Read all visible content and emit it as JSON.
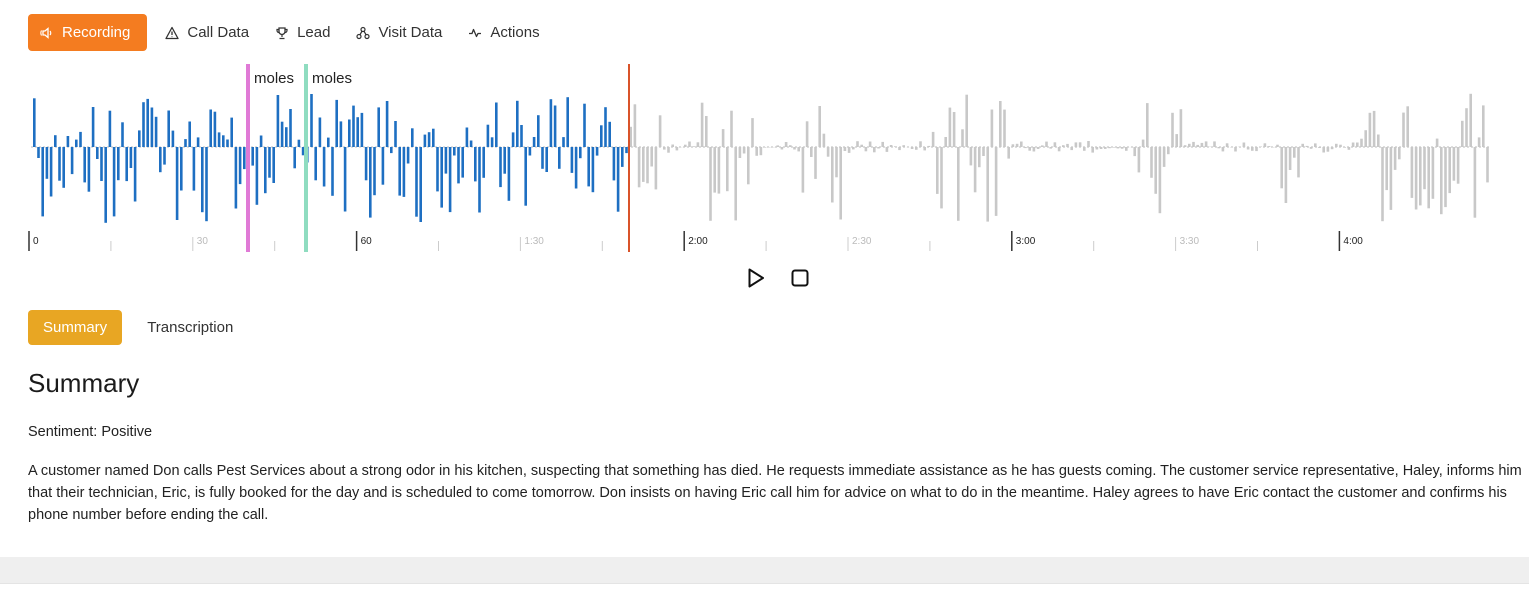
{
  "tabs": [
    {
      "label": "Recording",
      "icon": "speaker-icon",
      "active": true
    },
    {
      "label": "Call Data",
      "icon": "warning-triangle-icon",
      "active": false
    },
    {
      "label": "Lead",
      "icon": "trophy-icon",
      "active": false
    },
    {
      "label": "Visit Data",
      "icon": "network-icon",
      "active": false
    },
    {
      "label": "Actions",
      "icon": "pulse-icon",
      "active": false
    }
  ],
  "waveform": {
    "markers": [
      {
        "label": "moles",
        "color": "#e07ad6"
      },
      {
        "label": "moles",
        "color": "#8fdcc0"
      }
    ],
    "played_color": "#1e6fc2",
    "unplayed_color": "#c8c8c8",
    "playhead_color": "#d9532a",
    "time_labels": [
      {
        "label": "0",
        "major": true
      },
      {
        "label": "30",
        "major": false
      },
      {
        "label": "60",
        "major": true
      },
      {
        "label": "1:30",
        "major": false
      },
      {
        "label": "2:00",
        "major": true
      },
      {
        "label": "2:30",
        "major": false
      },
      {
        "label": "3:00",
        "major": true
      },
      {
        "label": "3:30",
        "major": false
      },
      {
        "label": "4:00",
        "major": true
      }
    ]
  },
  "controls": {
    "play": "play-icon",
    "stop": "stop-icon"
  },
  "subtabs": [
    {
      "label": "Summary",
      "active": true
    },
    {
      "label": "Transcription",
      "active": false
    }
  ],
  "summary": {
    "title": "Summary",
    "sentiment": "Sentiment: Positive",
    "text": "A customer named Don calls Pest Services about a strong odor in his kitchen, suspecting that something has died. He requests immediate assistance as he has guests coming. The customer service representative, Haley, informs him that their technician, Eric, is fully booked for the day and is scheduled to come tomorrow. Don insists on having Eric call him for advice on what to do in the meantime. Haley agrees to have Eric contact the customer and confirms his phone number before ending the call."
  }
}
